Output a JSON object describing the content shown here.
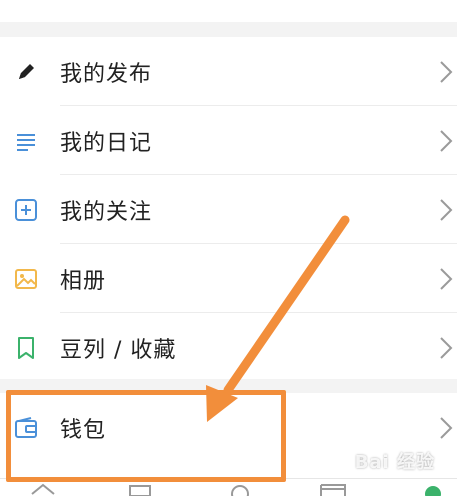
{
  "menu": {
    "items": [
      {
        "label": "我的发布",
        "icon": "pencil-icon"
      },
      {
        "label": "我的日记",
        "icon": "lines-icon"
      },
      {
        "label": "我的关注",
        "icon": "plus-square-icon"
      },
      {
        "label": "相册",
        "icon": "image-icon"
      },
      {
        "label": "豆列 / 收藏",
        "icon": "bookmark-icon"
      },
      {
        "label": "钱包",
        "icon": "wallet-icon"
      }
    ]
  },
  "watermark": {
    "text": "Bai 经验"
  },
  "colors": {
    "accent_orange": "#f28e3b",
    "icon_blue": "#4a90d9",
    "icon_yellow": "#f2b84b",
    "icon_green": "#3bb26b",
    "text_dark": "#222222",
    "chevron": "#9a9a9a"
  }
}
